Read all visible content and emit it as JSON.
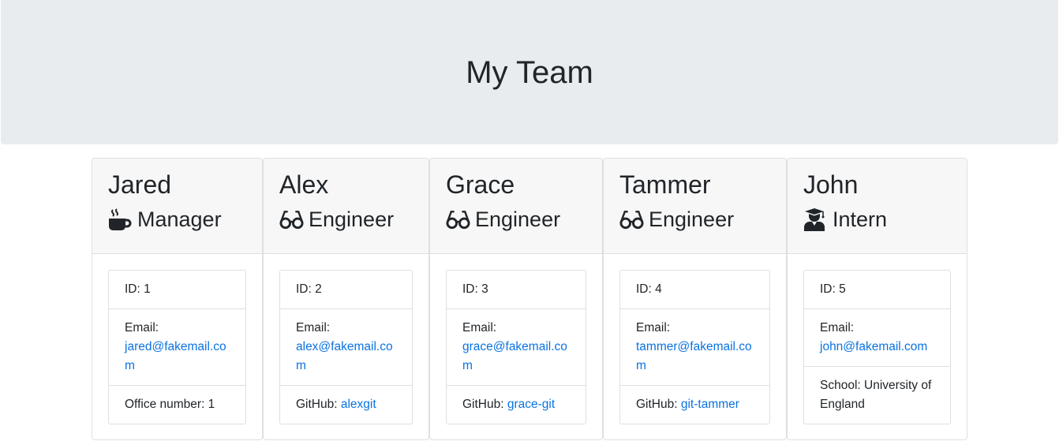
{
  "header": {
    "title": "My Team"
  },
  "members": [
    {
      "name": "Jared",
      "role": "Manager",
      "role_icon": "coffee-mug-icon",
      "id_text": "ID: 1",
      "email_label": "Email:",
      "email": "jared@fakemail.com",
      "extra_label": "Office number: 1",
      "extra_value": ""
    },
    {
      "name": "Alex",
      "role": "Engineer",
      "role_icon": "glasses-icon",
      "id_text": "ID: 2",
      "email_label": "Email:",
      "email": "alex@fakemail.com",
      "extra_label": "GitHub: ",
      "extra_value": "alexgit"
    },
    {
      "name": "Grace",
      "role": "Engineer",
      "role_icon": "glasses-icon",
      "id_text": "ID: 3",
      "email_label": "Email:",
      "email": "grace@fakemail.com",
      "extra_label": "GitHub: ",
      "extra_value": "grace-git"
    },
    {
      "name": "Tammer",
      "role": "Engineer",
      "role_icon": "glasses-icon",
      "id_text": "ID: 4",
      "email_label": "Email:",
      "email": "tammer@fakemail.com",
      "extra_label": "GitHub: ",
      "extra_value": "git-tammer"
    },
    {
      "name": "John",
      "role": "Intern",
      "role_icon": "graduate-icon",
      "id_text": "ID: 5",
      "email_label": "Email:",
      "email": "john@fakemail.com",
      "extra_label": "School: University of England",
      "extra_value": ""
    }
  ],
  "colors": {
    "link": "#0b73e0",
    "header_bg": "#e9ecef",
    "card_header_bg": "#f7f7f7"
  }
}
